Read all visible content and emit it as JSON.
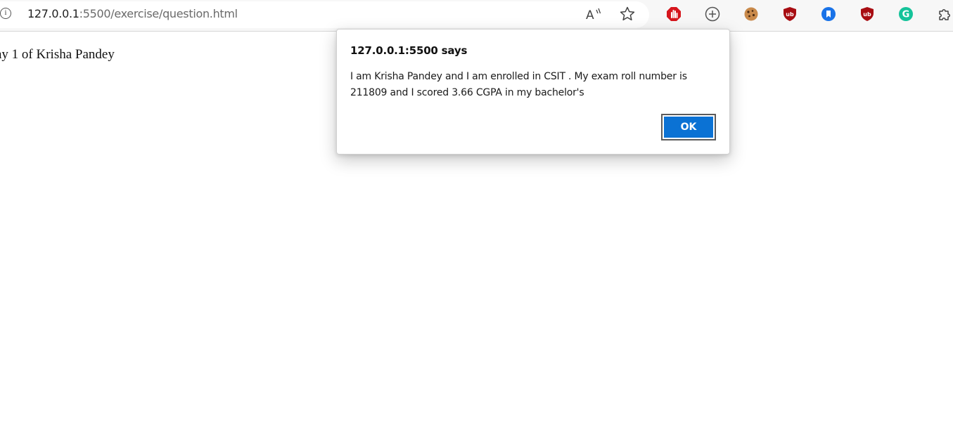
{
  "browser": {
    "url_host": "127.0.0.1",
    "url_rest": ":5500/exercise/question.html",
    "icons": [
      "info-icon",
      "read-aloud-icon",
      "favorite-star-icon"
    ],
    "extensions": [
      "adblock-stop-icon",
      "add-tab-plus-icon",
      "cookie-icon",
      "ublock-icon",
      "bookmark-extension-icon",
      "ublock-icon-2",
      "grammarly-icon",
      "extensions-puzzle-icon"
    ]
  },
  "page": {
    "text": "ay 1 of Krisha Pandey"
  },
  "dialog": {
    "title": "127.0.0.1:5500 says",
    "message": "I am Krisha Pandey and I am enrolled in CSIT . My exam roll number is 211809 and I scored 3.66 CGPA in my bachelor's",
    "ok_label": "OK"
  },
  "colors": {
    "ok_button": "#0b72d4",
    "adblock_red": "#d6161d",
    "ublock_red": "#a80d12",
    "bookmark_blue": "#1a73e8",
    "grammarly_green": "#15c39a"
  }
}
